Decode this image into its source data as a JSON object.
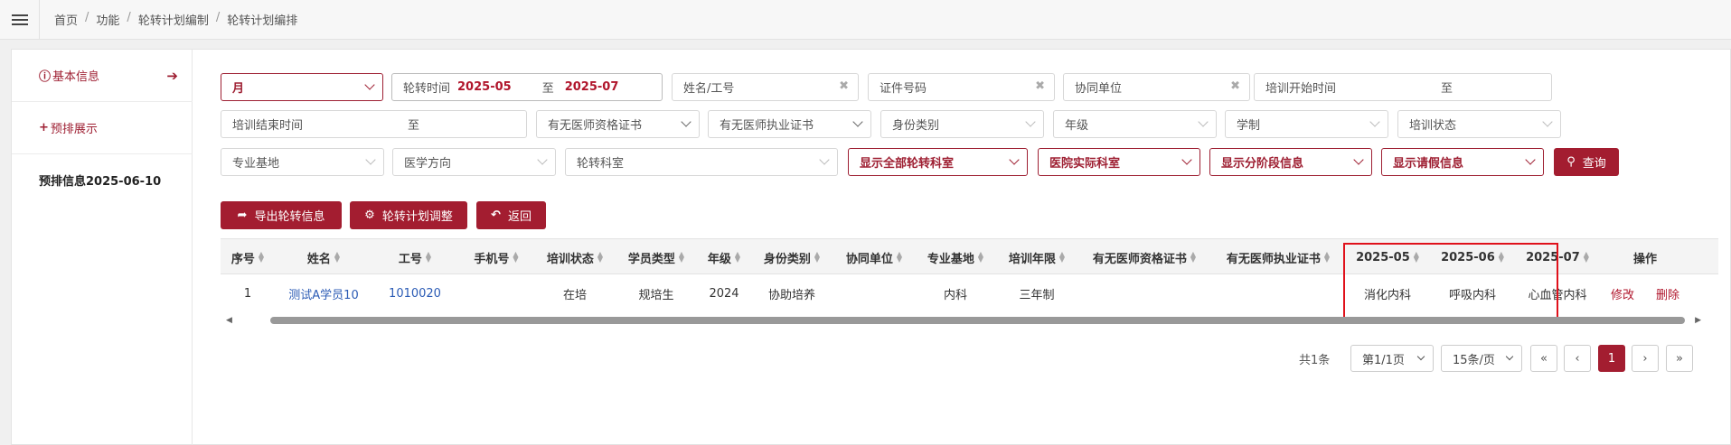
{
  "breadcrumb": [
    "首页",
    "功能",
    "轮转计划编制",
    "轮转计划编排"
  ],
  "sidebar": {
    "items": [
      {
        "label": "基本信息",
        "icon": "info-circle-icon"
      },
      {
        "label": "预排展示",
        "icon": "plus-icon"
      }
    ],
    "info_label": "预排信息2025-06-10"
  },
  "filters": {
    "period_type": "月",
    "rotation_time_label": "轮转时间",
    "rotation_start": "2025-05",
    "rotation_to": "至",
    "rotation_end": "2025-07",
    "name_placeholder": "姓名/工号",
    "id_placeholder": "证件号码",
    "coop_unit_placeholder": "协同单位",
    "train_start_label": "培训开始时间",
    "train_start_to": "至",
    "train_end_label": "培训结束时间",
    "train_end_to": "至",
    "qualification_cert": "有无医师资格证书",
    "practice_cert": "有无医师执业证书",
    "identity_type": "身份类别",
    "grade": "年级",
    "education": "学制",
    "training_status": "培训状态",
    "specialty_base": "专业基地",
    "medical_direction": "医学方向",
    "rotation_dept": "轮转科室",
    "show_all_depts": "显示全部轮转科室",
    "hospital_dept": "医院实际科室",
    "show_stage": "显示分阶段信息",
    "show_leave": "显示请假信息",
    "search_btn": "查询"
  },
  "actions": {
    "export": "导出轮转信息",
    "adjust": "轮转计划调整",
    "back": "返回"
  },
  "table": {
    "headers": [
      "序号",
      "姓名",
      "工号",
      "手机号",
      "培训状态",
      "学员类型",
      "年级",
      "身份类别",
      "协同单位",
      "专业基地",
      "培训年限",
      "有无医师资格证书",
      "有无医师执业证书",
      "2025-05",
      "2025-06",
      "2025-07",
      "操作"
    ],
    "rows": [
      {
        "index": "1",
        "name": "测试A学员10",
        "emp_no": "1010020",
        "phone": "",
        "status": "在培",
        "student_type": "规培生",
        "grade": "2024",
        "identity": "协助培养",
        "coop_unit": "",
        "base": "内科",
        "years": "三年制",
        "qual_cert": "",
        "prac_cert": "",
        "m1": "消化内科",
        "m2": "呼吸内科",
        "m3": "心血管内科",
        "edit": "修改",
        "delete": "删除"
      }
    ]
  },
  "pagination": {
    "total": "共1条",
    "page_info": "第1/1页",
    "page_size": "15条/页",
    "first": "«",
    "prev": "‹",
    "current": "1",
    "next": "›",
    "last": "»"
  },
  "colors": {
    "accent": "#a31d30",
    "highlight_box": "#e0111b",
    "link": "#2b5bb5"
  }
}
